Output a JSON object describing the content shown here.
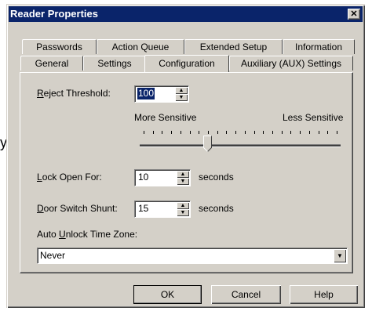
{
  "stray_char": "y",
  "window": {
    "title": "Reader Properties",
    "close_glyph": "✕"
  },
  "tabs_back": [
    "Passwords",
    "Action Queue",
    "Extended Setup",
    "Information"
  ],
  "tabs_front": [
    "General",
    "Settings",
    "Configuration",
    "Auxiliary (AUX) Settings"
  ],
  "active_tab": "Configuration",
  "reject_threshold": {
    "label_underlined": "R",
    "label_rest": "eject Threshold:",
    "value": "100"
  },
  "slider": {
    "left_label": "More Sensitive",
    "right_label": "Less Sensitive",
    "tick_count": 22,
    "thumb_position": 0.33
  },
  "lock_open": {
    "label_underlined": "L",
    "label_rest": "ock Open For:",
    "value": "10",
    "unit": "seconds"
  },
  "door_shunt": {
    "label_underlined": "D",
    "label_rest": "oor Switch Shunt:",
    "value": "15",
    "unit": "seconds"
  },
  "auto_unlock": {
    "label_pre": "Auto ",
    "label_underlined": "U",
    "label_rest": "nlock Time Zone:",
    "value": "Never"
  },
  "buttons": {
    "ok": "OK",
    "cancel": "Cancel",
    "help": "Help"
  }
}
